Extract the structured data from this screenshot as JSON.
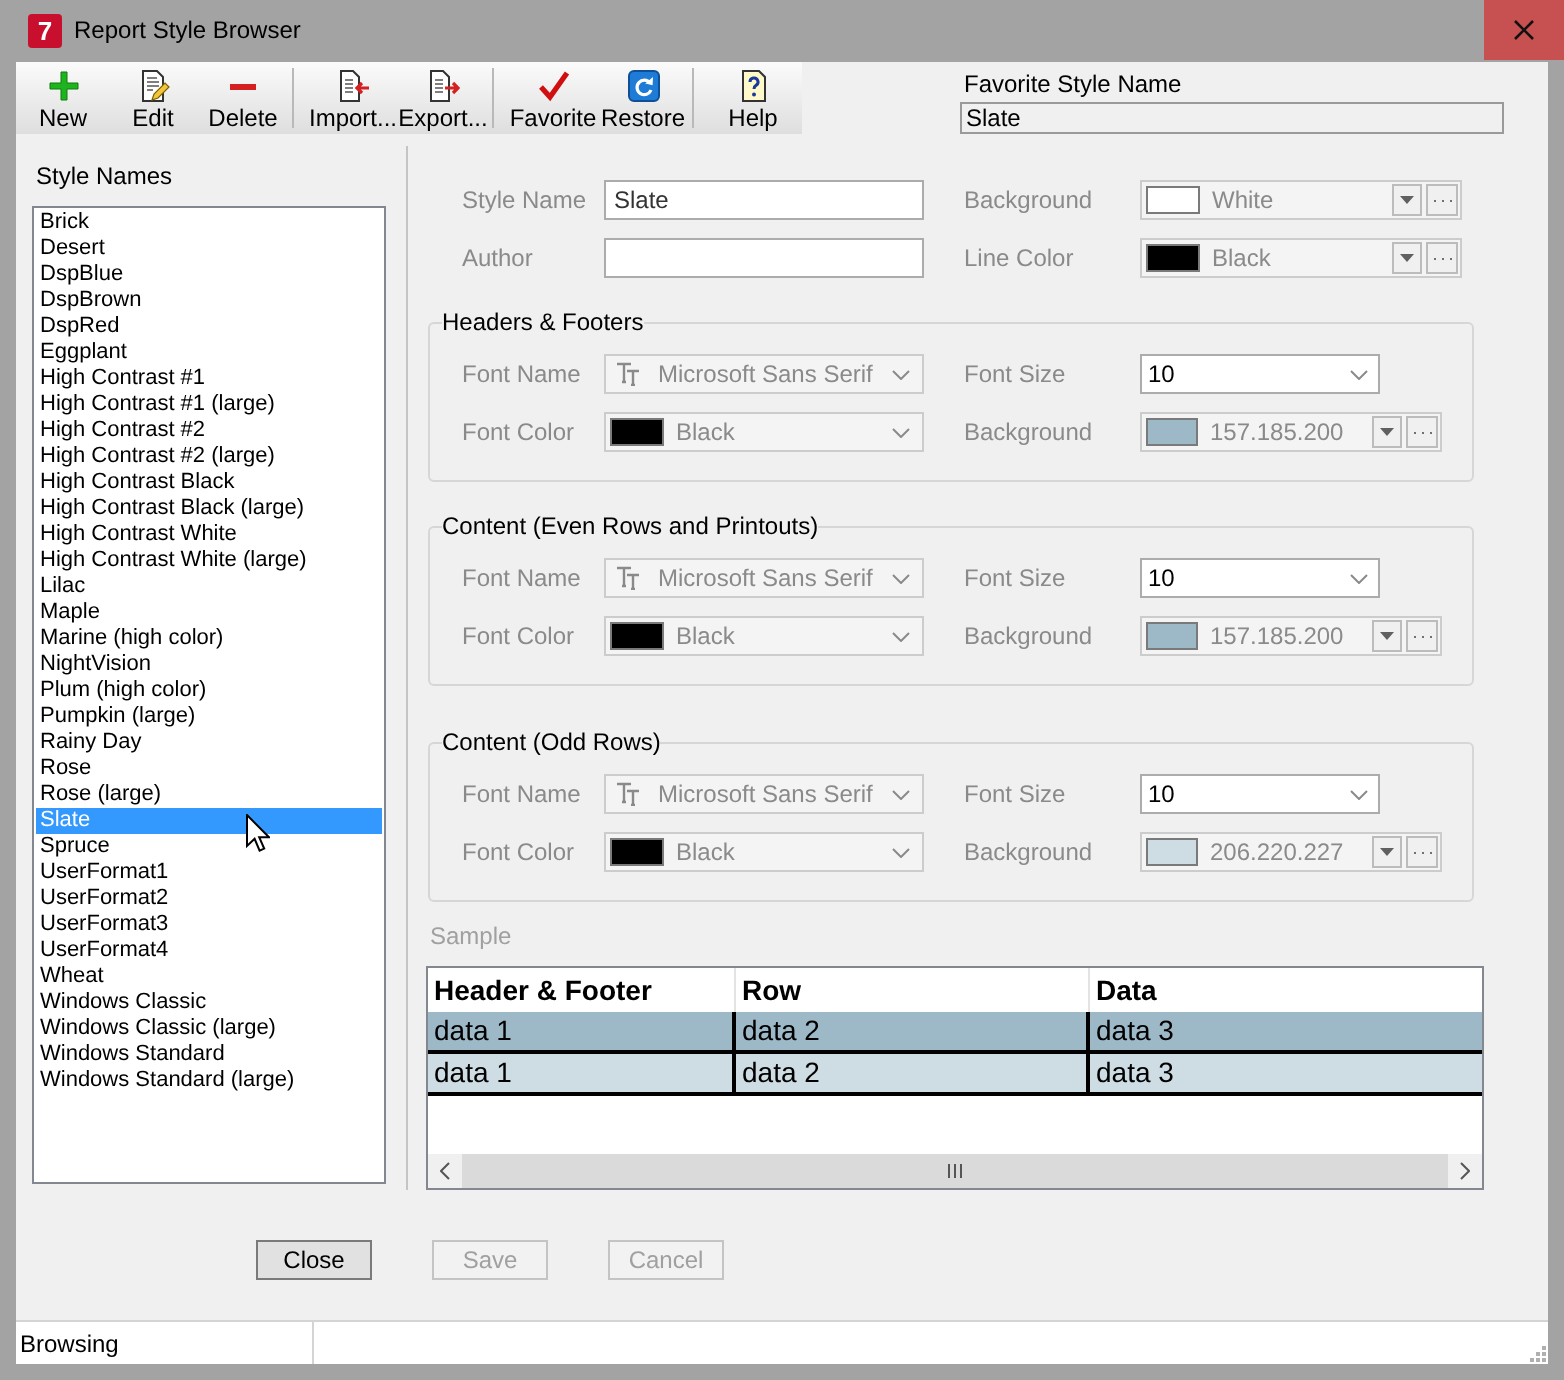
{
  "window": {
    "logo": "7",
    "title": "Report Style Browser"
  },
  "toolbar": {
    "groups": [
      [
        {
          "label": "New"
        },
        {
          "label": "Edit"
        },
        {
          "label": "Delete"
        }
      ],
      [
        {
          "label": "Import..."
        },
        {
          "label": "Export..."
        }
      ],
      [
        {
          "label": "Favorite"
        },
        {
          "label": "Restore"
        }
      ],
      [
        {
          "label": "Help"
        }
      ]
    ]
  },
  "favorite": {
    "label": "Favorite Style Name",
    "value": "Slate"
  },
  "style_list": {
    "label": "Style Names",
    "items": [
      {
        "name": "Brick",
        "selected": false
      },
      {
        "name": "Desert",
        "selected": false
      },
      {
        "name": "DspBlue",
        "selected": false
      },
      {
        "name": "DspBrown",
        "selected": false
      },
      {
        "name": "DspRed",
        "selected": false
      },
      {
        "name": "Eggplant",
        "selected": false
      },
      {
        "name": "High Contrast #1",
        "selected": false
      },
      {
        "name": "High Contrast #1 (large)",
        "selected": false
      },
      {
        "name": "High Contrast #2",
        "selected": false
      },
      {
        "name": "High Contrast #2 (large)",
        "selected": false
      },
      {
        "name": "High Contrast Black",
        "selected": false
      },
      {
        "name": "High Contrast Black (large)",
        "selected": false
      },
      {
        "name": "High Contrast White",
        "selected": false
      },
      {
        "name": "High Contrast White (large)",
        "selected": false
      },
      {
        "name": "Lilac",
        "selected": false
      },
      {
        "name": "Maple",
        "selected": false
      },
      {
        "name": "Marine (high color)",
        "selected": false
      },
      {
        "name": "NightVision",
        "selected": false
      },
      {
        "name": "Plum (high color)",
        "selected": false
      },
      {
        "name": "Pumpkin (large)",
        "selected": false
      },
      {
        "name": "Rainy Day",
        "selected": false
      },
      {
        "name": "Rose",
        "selected": false
      },
      {
        "name": "Rose (large)",
        "selected": false
      },
      {
        "name": "Slate",
        "selected": true
      },
      {
        "name": "Spruce",
        "selected": false
      },
      {
        "name": "UserFormat1",
        "selected": false
      },
      {
        "name": "UserFormat2",
        "selected": false
      },
      {
        "name": "UserFormat3",
        "selected": false
      },
      {
        "name": "UserFormat4",
        "selected": false
      },
      {
        "name": "Wheat",
        "selected": false
      },
      {
        "name": "Windows Classic",
        "selected": false
      },
      {
        "name": "Windows Classic (large)",
        "selected": false
      },
      {
        "name": "Windows Standard",
        "selected": false
      },
      {
        "name": "Windows Standard (large)",
        "selected": false
      }
    ]
  },
  "general": {
    "rows": [
      [
        {
          "kind": "text",
          "label": "Style Name",
          "value": "Slate",
          "disabled": false
        },
        {
          "kind": "picker",
          "label": "Background",
          "value": "White",
          "color": "#ffffff",
          "disabled": true
        }
      ],
      [
        {
          "kind": "text",
          "label": "Author",
          "disabled": false
        },
        {
          "kind": "picker",
          "label": "Line Color",
          "value": "Black",
          "color": "#000000",
          "disabled": true
        }
      ]
    ]
  },
  "groups": [
    {
      "title": "Headers & Footers",
      "rows": [
        [
          {
            "kind": "font",
            "label": "Font Name",
            "value": "Microsoft Sans Serif",
            "disabled": true
          },
          {
            "kind": "size",
            "label": "Font Size",
            "value": "10",
            "disabled": false
          }
        ],
        [
          {
            "kind": "color",
            "label": "Font Color",
            "value": "Black",
            "color": "#000000",
            "disabled": true
          },
          {
            "kind": "picker",
            "label": "Background",
            "value": "157.185.200",
            "color": "#9db9c8",
            "disabled": true
          }
        ]
      ]
    },
    {
      "title": "Content (Even Rows and Printouts)",
      "rows": [
        [
          {
            "kind": "font",
            "label": "Font Name",
            "value": "Microsoft Sans Serif",
            "disabled": true
          },
          {
            "kind": "size",
            "label": "Font Size",
            "value": "10",
            "disabled": false
          }
        ],
        [
          {
            "kind": "color",
            "label": "Font Color",
            "value": "Black",
            "color": "#000000",
            "disabled": true
          },
          {
            "kind": "picker",
            "label": "Background",
            "value": "157.185.200",
            "color": "#9db9c8",
            "disabled": true
          }
        ]
      ]
    },
    {
      "title": "Content (Odd Rows)",
      "rows": [
        [
          {
            "kind": "font",
            "label": "Font Name",
            "value": "Microsoft Sans Serif",
            "disabled": true
          },
          {
            "kind": "size",
            "label": "Font Size",
            "value": "10",
            "disabled": false
          }
        ],
        [
          {
            "kind": "color",
            "label": "Font Color",
            "value": "Black",
            "color": "#000000",
            "disabled": true
          },
          {
            "kind": "picker",
            "label": "Background",
            "value": "206.220.227",
            "color": "#cedce3",
            "disabled": true
          }
        ]
      ]
    }
  ],
  "sample": {
    "label": "Sample",
    "columns": [
      "Header & Footer",
      "Row",
      "Data"
    ],
    "rows": [
      {
        "color": "#9db9c8",
        "cells": [
          "data 1",
          "data 2",
          "data 3"
        ]
      },
      {
        "color": "#cedce3",
        "cells": [
          "data 1",
          "data 2",
          "data 3"
        ]
      }
    ]
  },
  "buttons": [
    {
      "label": "Close",
      "disabled": false
    },
    {
      "label": "Save",
      "disabled": true
    },
    {
      "label": "Cancel",
      "disabled": true
    }
  ],
  "status_bar": {
    "text": "Browsing"
  }
}
